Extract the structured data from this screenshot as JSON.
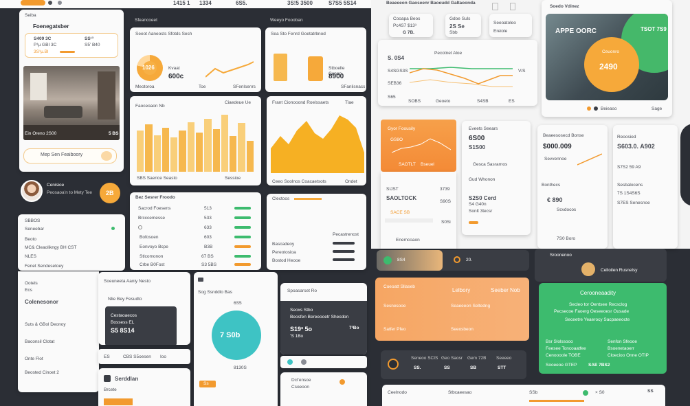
{
  "colors": {
    "accent": "#f29a2e",
    "green": "#3dbb6e",
    "dark": "#2b2e35",
    "teal": "#3ec3c4"
  },
  "topstrip": {
    "v1": "1415 1",
    "v2": "1334",
    "v3": "6S5.",
    "v4": "3S!5 3500",
    "v5": "S7S5 5S14"
  },
  "left": {
    "head_small": "Seiba",
    "title": "Foenegatsber",
    "stat1_a": "S409 3C",
    "stat1_b": "P¹µ GBI 3C",
    "stat1_c": "3S¹µ.Bl",
    "stat2_a": "SS¹³",
    "stat2_b": "S5’ B40",
    "photo_caption": "Ein Oreno 2S00",
    "photo_value": "5 BS",
    "pill_label": "Mep Sen Feaiboory",
    "profile_name": "Cenisioe",
    "profile_sub": "Peosaoa’n to Mety Tee",
    "badge": "2B",
    "list_title": "SBBOS",
    "list_items": [
      "Seneebar",
      "Beoto",
      "MC& Cleaolikngy BH CST",
      "NLES",
      "Fenet Sendesetoey"
    ],
    "list_lower": [
      "Ootels",
      "Ecs",
      "Colenesonor",
      "Suts & GBol Deonoy",
      "Baconsil Clotat",
      "Onte Flot",
      "Beosted Cinoet 2"
    ]
  },
  "col2": {
    "top_head": "Sfeancoeet",
    "card1_title": "Seeot Aaneosts Sfotds Sesh",
    "donut_val": "1026",
    "donut_label": "Kvaat",
    "donut_num": "600c",
    "foot": "Meotoroa",
    "foot2": "Toe",
    "foot3": "SFenlsenrs",
    "card2_title": "Faoceoaon Nb",
    "card2_right": "Ciaedeue Ue",
    "card2_foot": "SBS Saerice Seasto",
    "card2_foot2": "Sessioe",
    "card3_title": "Bez Sesrer Froodo",
    "rows": [
      {
        "label": "Sacrod Foesens",
        "value": "513"
      },
      {
        "label": "Brcccemesse",
        "value": "533"
      },
      {
        "label": "Bofosoen",
        "value": "633"
      },
      {
        "label": "Eonvoyo Bcpe",
        "value": "603"
      },
      {
        "label": "Stlcomonon",
        "value": "B3B"
      },
      {
        "label": "Crbe B0Fost",
        "value": "67 BS"
      }
    ],
    "r3": "S3 5BS"
  },
  "col3": {
    "top_head": "Weeyo Foooban",
    "card1_title": "Sea Sto Fenrd Goetatrbnod",
    "val1": "Stboelle",
    "val2": "Cenon",
    "val3": "8900",
    "foot": "SFanlisnacs",
    "card2_title": "Frant Cionooond Roelssaets",
    "card2_right": "Tlae",
    "card2_foot": "Ceeo Soolnos Coacaetsots",
    "card2_foot2": "Ondet",
    "card3_title": "Clectoos",
    "c3r1": "Pecastrenost",
    "c3r2": "Bascadeoy",
    "c3r3": "Pereotosioa",
    "c3r4": "Bostod Heooe"
  },
  "bottom_left": {
    "sig": "Soeuneeta Aaniy Nesto",
    "sub": "Nlie Bey Fesudto",
    "dark_title": "Cestaoaecos",
    "dark_sub": "Bossess EL",
    "dark_val": "S5 8S14",
    "chip1": "ES",
    "chip2": "CBS S5oesen",
    "chip3": "Ioo",
    "section": "Serddlan",
    "sec_sub": "Brcete"
  },
  "teal_card": {
    "title": "Sog Ssnddlo Bas",
    "top_val": "6S5",
    "value": "7 S0b",
    "foot": "8130S",
    "btn": "Ss"
  },
  "dark_small": {
    "title": "Spoasarset Ro",
    "sub": "Seoxs Stbo",
    "text": "Beosfen Bereeooetr Shecdon",
    "v1": "S19³ 5o",
    "v2": "7³Bo",
    "s1": "’S 1Bo",
    "foot1": "Dcl’ensoe",
    "foot2": "Csoeoon"
  },
  "right": {
    "top_title": "Beaeeeon Gaoseenr Baoeudd Galtaoonda",
    "tile1_a": "Cooapa Beos",
    "tile1_b": "Pc4S7 $13³",
    "tile1_c": "G 7B.",
    "tile2_a": "Gdoe Suls",
    "tile2_b": "2S Se",
    "tile2_c": "Sbb",
    "tile3_a": "Seeoatoleo",
    "tile3_b": "Ereiole",
    "chart_title": "Pecotnet Aloe",
    "chart_l1": "S. 0S4",
    "chart_l2": "S4SGS3S",
    "chart_l3": "SEB36",
    "chart_l4": "S65",
    "chart_r": "V/S",
    "chart_legend": [
      "SOBS",
      "Geoeto",
      "S4SB",
      "ES"
    ],
    "hero_label": "Soedo Vdinez",
    "hero_title": "APPE OORC",
    "hero_val": "TSOT 7S9",
    "hero_orb": "2490",
    "hero_orb_sub": "Ceuonro",
    "hero_foot1": "Beieaso",
    "hero_foot2": "Sage",
    "orange_card_title": "Gyor Foousily",
    "orange_val": "GS8O",
    "orange_sub": "SAOTLT",
    "orange_sub2": "Bseuel",
    "list1": [
      {
        "l": "SIJST",
        "v": "3739"
      },
      {
        "l": "SAOLTOCK",
        "v": "S90S"
      },
      {
        "l": "SACE SB",
        "v": "S0Si"
      }
    ],
    "list1_foot": "Enemcoaon",
    "mid_a": "Eveets Seears",
    "mid_b": "6S00",
    "mid_c": "S1S00",
    "mid_d": "Gesca Sasrarnos",
    "mid_e": "Gud Whonon",
    "mid_f": "S2S0 Cerd",
    "mid_g": "S4 G40n",
    "mid_h": "Sonlt 3tecsr",
    "stat_title": "Beaeesosecd Bonse",
    "stat_val": "$000.009",
    "stat_sub": "Sevvennoe",
    "stat_s2": "Bonthecs",
    "stat_big": "€ 890",
    "stat_s3": "Scvdocos",
    "stat_s4": "7S0 Boro",
    "far_title": "Reoosied",
    "far_val": "S603.0. A902",
    "far_a": "S7S2 59 A9",
    "far_b": "Sesbalocens",
    "far_c": "7S 1S4S6S",
    "far_d": "S7ES Senesnoe"
  },
  "bottom_right": {
    "bar1_a": "8S4",
    "bar1_b": "20.",
    "bar2_a": "Sroonenoo",
    "bar2_b": "Celloilen Rusnelsy",
    "orange_t1": "Coeoatt Sllaseb",
    "orange_t2": "Lelbory",
    "orange_t3": "Seeber Nob",
    "orange_t4": "Sesnesooe",
    "orange_t5": "Seaeeeon Seltedng",
    "orange_t6": "Satfer Pfeo",
    "orange_t7": "Seeosbeon",
    "green_title": "Cerooneaadity",
    "green_l1": "Secleo tor Oentsee Recsclog",
    "green_l2": "Pecsecoe Faoerg Oeseeoesr Ousade",
    "green_l3": "Seceetre Yeaerocy Sacpaeeocte",
    "green_a": "Bsr Slolssooo",
    "green_b": "Senfon Sfeooe",
    "green_c": "Feesee Toncoaatfee",
    "green_d": "Bsoenetaoerr",
    "green_e": "Cenoooole TOBE",
    "green_f": "Cloecioo Onne OTIP",
    "green_g": "Sooeeoe GTEP",
    "green_h": "SAE 7BS2",
    "dark_strip": [
      "Seneoo SCIS",
      "Geo Saosr",
      "Gem 72B",
      "Seeeeo"
    ],
    "dark_vals": [
      "SS.",
      "SS",
      "SB",
      "STT"
    ],
    "foot": [
      "Ceelnodo",
      "Stbcaeesao",
      "SSb",
      "× S0"
    ],
    "foot_end": "SS"
  }
}
